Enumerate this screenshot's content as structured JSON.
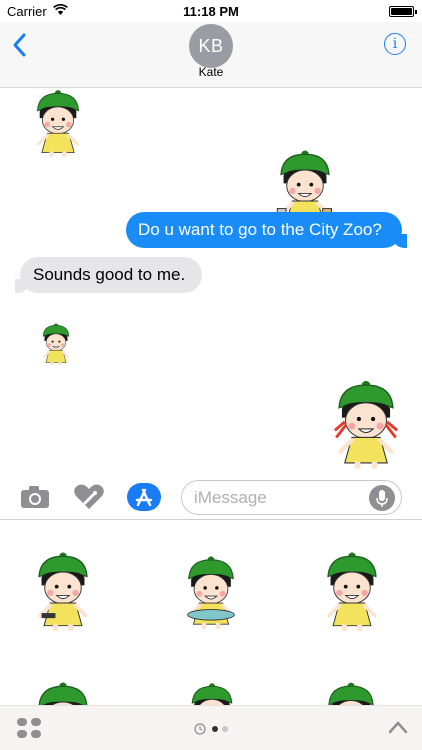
{
  "status_bar": {
    "carrier": "Carrier",
    "time": "11:18 PM"
  },
  "header": {
    "avatar_initials": "KB",
    "contact_name": "Kate",
    "back_icon": "chevron-left-icon",
    "info_icon": "info-icon",
    "info_glyph": "i"
  },
  "messages": [
    {
      "type": "sticker",
      "direction": "incoming",
      "character": "girl-waving"
    },
    {
      "type": "sticker",
      "direction": "outgoing",
      "character": "girl-shopping-bags"
    },
    {
      "type": "text",
      "direction": "outgoing",
      "text": "Do u want to go to the City Zoo?"
    },
    {
      "type": "text",
      "direction": "incoming",
      "text": "Sounds good to me."
    },
    {
      "type": "sticker",
      "direction": "incoming",
      "character": "girl-small"
    },
    {
      "type": "sticker",
      "direction": "outgoing",
      "character": "girl-crying"
    }
  ],
  "input_bar": {
    "camera_icon": "camera-icon",
    "digital_touch_icon": "heart-touch-icon",
    "app_store_icon": "app-store-icon",
    "placeholder": "iMessage",
    "mic_icon": "microphone-icon"
  },
  "sticker_drawer": {
    "stickers": [
      "girl-sitting-phone",
      "boy-eating",
      "girl-surprised",
      "girl-partial",
      "boy-partial",
      "girl-partial-2"
    ]
  },
  "bottom_bar": {
    "apps_icon": "app-drawer-icon",
    "pager_pages": 3,
    "pager_active": 2,
    "collapse_icon": "chevron-up-icon"
  },
  "colors": {
    "outgoing_bubble": "#1a8cf7",
    "incoming_bubble": "#e5e5ea",
    "accent": "#1a7cf5"
  }
}
